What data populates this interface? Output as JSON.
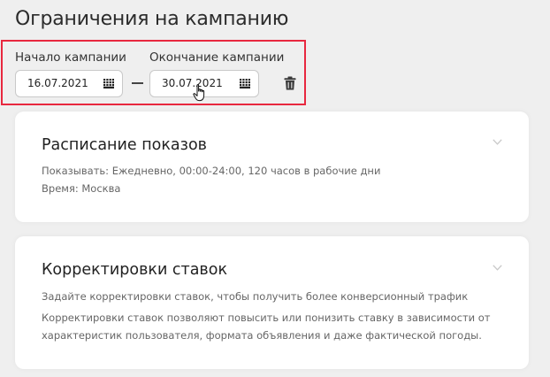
{
  "page": {
    "title": "Ограничения на кампанию"
  },
  "dates": {
    "start_label": "Начало кампании",
    "start_value": "16.07.2021",
    "end_label": "Окончание кампании",
    "end_value": "30.07.2021",
    "highlight_color": "#e8283f"
  },
  "schedule": {
    "title": "Расписание показов",
    "line1": "Показывать: Ежедневно, 00:00-24:00, 120 часов в рабочие дни",
    "line2": "Время: Москва"
  },
  "bids": {
    "title": "Корректировки ставок",
    "line1": "Задайте корректировки ставок, чтобы получить более конверсионный трафик",
    "line2": "Корректировки ставок позволяют повысить или понизить ставку в зависимости от",
    "line3": "характеристик пользователя, формата объявления и даже фактической погоды."
  },
  "icons": {
    "calendar": "calendar-icon",
    "trash": "trash-icon",
    "chevron": "chevron-down-icon",
    "cursor": "hand-cursor-icon"
  }
}
